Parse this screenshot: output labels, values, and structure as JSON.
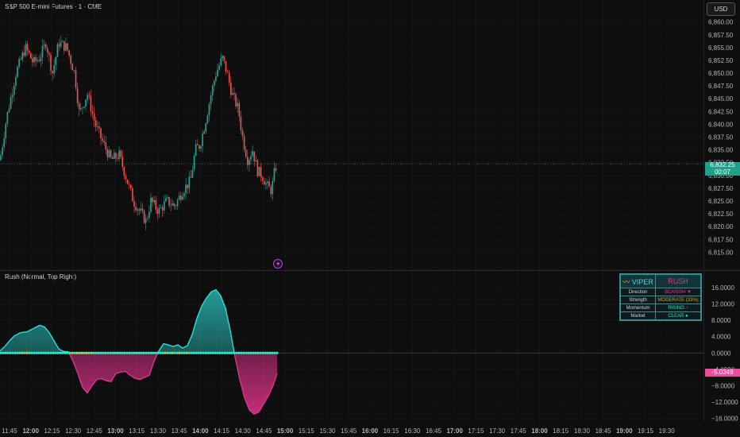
{
  "header": {
    "symbol_title": "S&P 500 E-mini Futures · 1 · CME",
    "currency_button": "USD"
  },
  "indicator": {
    "title": "Rush (Normal, Top Right)"
  },
  "price_tag": {
    "price": "6,832.25",
    "countdown": "00:07"
  },
  "value_tag": {
    "value": "-5.0349"
  },
  "colors": {
    "bull": "#26a69a",
    "bear": "#ef5350",
    "cyan": "#2ee6e0",
    "magenta": "#e6338e",
    "zero_dots": "#2ee6c8",
    "yellow_dots": "#e5b83a"
  },
  "panel": {
    "brand": "VIPER",
    "signal": "RUSH",
    "rows": [
      {
        "label": "Direction",
        "value": "BEARISH ▼"
      },
      {
        "label": "Strength",
        "value": "MODERATE (33%)"
      },
      {
        "label": "Momentum",
        "value": "RISING ↑"
      },
      {
        "label": "Market",
        "value": "CLEAR ●"
      }
    ]
  },
  "chart_data": [
    {
      "type": "candlestick",
      "ylim": [
        6813.5,
        6861.5
      ],
      "yticks": [
        "6,860.00",
        "6,857.50",
        "6,855.00",
        "6,852.50",
        "6,850.00",
        "6,847.50",
        "6,845.00",
        "6,842.50",
        "6,840.00",
        "6,837.50",
        "6,835.00",
        "6,832.50",
        "6,830.00",
        "6,827.50",
        "6,825.00",
        "6,822.50",
        "6,820.00",
        "6,817.50",
        "6,815.00"
      ],
      "last_price": 6832.25,
      "path": [
        [
          0,
          6833
        ],
        [
          8,
          6841
        ],
        [
          20,
          6850
        ],
        [
          32,
          6855
        ],
        [
          42,
          6852
        ],
        [
          50,
          6853
        ],
        [
          58,
          6856
        ],
        [
          66,
          6850
        ],
        [
          74,
          6856
        ],
        [
          84,
          6855
        ],
        [
          94,
          6850
        ],
        [
          100,
          6842
        ],
        [
          110,
          6846
        ],
        [
          120,
          6840
        ],
        [
          128,
          6837
        ],
        [
          140,
          6833
        ],
        [
          150,
          6834
        ],
        [
          158,
          6830
        ],
        [
          168,
          6825
        ],
        [
          176,
          6823
        ],
        [
          184,
          6821
        ],
        [
          190,
          6825
        ],
        [
          200,
          6823
        ],
        [
          210,
          6825
        ],
        [
          220,
          6824
        ],
        [
          230,
          6827
        ],
        [
          240,
          6829
        ],
        [
          246,
          6835
        ],
        [
          252,
          6836
        ],
        [
          258,
          6840
        ],
        [
          266,
          6846
        ],
        [
          272,
          6850
        ],
        [
          280,
          6853
        ],
        [
          286,
          6850
        ],
        [
          292,
          6846
        ],
        [
          300,
          6843
        ],
        [
          306,
          6837
        ],
        [
          312,
          6833
        ],
        [
          318,
          6835
        ],
        [
          324,
          6831
        ],
        [
          330,
          6830
        ],
        [
          336,
          6828
        ],
        [
          342,
          6827
        ],
        [
          346,
          6831
        ],
        [
          349,
          6832.25
        ]
      ]
    },
    {
      "type": "area",
      "ylim": [
        -16.5,
        17
      ],
      "yticks": [
        "16.0000",
        "12.0000",
        "8.0000",
        "4.0000",
        "0.0000",
        "−4.0000",
        "−8.0000",
        "−12.0000",
        "−16.0000"
      ],
      "x": [
        0,
        6,
        12,
        18,
        26,
        34,
        42,
        50,
        56,
        62,
        68,
        74,
        80,
        86,
        92,
        98,
        104,
        110,
        116,
        122,
        128,
        134,
        140,
        146,
        152,
        158,
        164,
        170,
        176,
        182,
        188,
        194,
        200,
        206,
        212,
        218,
        224,
        230,
        236,
        242,
        248,
        254,
        260,
        266,
        272,
        278,
        284,
        290,
        296,
        302,
        308,
        314,
        320,
        326,
        332,
        338,
        344,
        349
      ],
      "values": [
        0.5,
        1.6,
        3.0,
        4.2,
        5.0,
        5.2,
        6.0,
        6.8,
        6.4,
        5.0,
        3.0,
        1.0,
        0.4,
        0.3,
        -2.0,
        -5.0,
        -8.5,
        -9.8,
        -8.0,
        -6.5,
        -6.3,
        -6.8,
        -7.0,
        -5.0,
        -4.7,
        -4.5,
        -5.5,
        -6.2,
        -6.5,
        -6.0,
        -5.5,
        -2.0,
        0.5,
        2.3,
        2.0,
        1.6,
        2.0,
        1.2,
        1.8,
        4.5,
        8.5,
        11.5,
        13.5,
        15.0,
        15.5,
        14.0,
        11.0,
        5.5,
        -1.0,
        -6.5,
        -11.0,
        -14.0,
        -15.0,
        -14.5,
        -12.5,
        -10.5,
        -8.0,
        -5.0
      ]
    }
  ],
  "x_axis": {
    "labels": [
      "11:45",
      "12:00",
      "12:15",
      "12:30",
      "12:45",
      "13:00",
      "13:15",
      "13:30",
      "13:45",
      "14:00",
      "14:15",
      "14:30",
      "14:45",
      "15:00",
      "15:15",
      "15:30",
      "15:45",
      "16:00",
      "16:15",
      "16:30",
      "16:45",
      "17:00",
      "17:15",
      "17:30",
      "17:45",
      "18:00",
      "18:15",
      "18:30",
      "18:45",
      "19:00",
      "19:15",
      "19:30"
    ],
    "bold": [
      "12:00",
      "13:00",
      "14:00",
      "15:00",
      "16:00",
      "17:00",
      "18:00",
      "19:00"
    ]
  }
}
